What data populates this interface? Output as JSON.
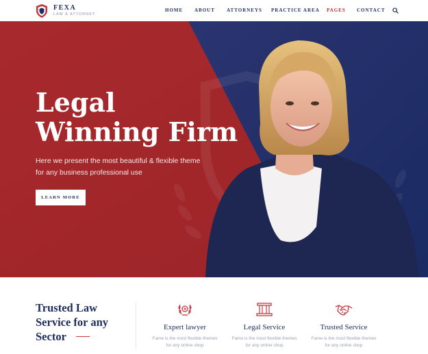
{
  "brand": {
    "name": "FEXA",
    "tagline": "LAW & ATTORNEY"
  },
  "nav": {
    "items": [
      {
        "label": "HOME"
      },
      {
        "label": "ABOUT"
      },
      {
        "label": "ATTORNEYS"
      },
      {
        "label": "PRACTICE AREA"
      },
      {
        "label": "PAGES",
        "active": true
      },
      {
        "label": "CONTACT"
      }
    ],
    "search_icon": "search-icon"
  },
  "hero": {
    "title_line1": "Legal",
    "title_line2": "Winning Firm",
    "subtitle_line1": "Here we present the most beautiful & flexible theme",
    "subtitle_line2": "for any business professional use",
    "button_label": "LEARN MORE"
  },
  "features": {
    "heading_line1": "Trusted Law",
    "heading_line2": "Service for any",
    "heading_line3": "Sector",
    "items": [
      {
        "icon": "laurel-icon",
        "title": "Expert lawyer",
        "text_line1": "Fame is the most flexible themes",
        "text_line2": "for any online shop"
      },
      {
        "icon": "pillar-icon",
        "title": "Legal Service",
        "text_line1": "Fame is the most flexible themes",
        "text_line2": "for any online shop"
      },
      {
        "icon": "handshake-icon",
        "title": "Trusted Service",
        "text_line1": "Fame is the most flexible themes",
        "text_line2": "for any online shop"
      }
    ]
  },
  "colors": {
    "navy": "#1e2b5c",
    "red": "#a5282c",
    "accent_red": "#b92a30",
    "white": "#ffffff"
  }
}
